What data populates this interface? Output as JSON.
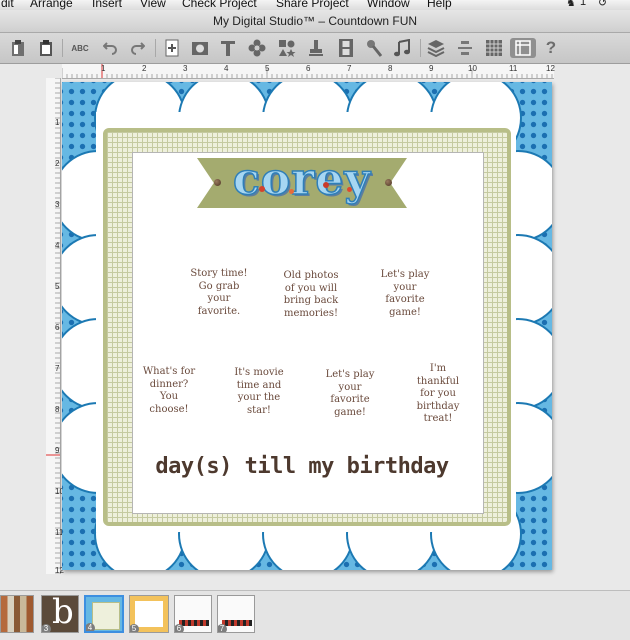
{
  "menubar": {
    "items": [
      "dit",
      "Arrange",
      "Insert",
      "View",
      "Check Project",
      "Share Project",
      "Window",
      "Help"
    ],
    "status_count": "1"
  },
  "window": {
    "title": "My Digital Studio™ – Countdown FUN"
  },
  "toolbar": {
    "icons": [
      "clipboard-icon",
      "paste-icon",
      "spell-check-icon",
      "undo-icon",
      "redo-icon",
      "add-page-icon",
      "photo-box-icon",
      "text-tool-icon",
      "embellishment-icon",
      "shapes-icon",
      "stamp-icon",
      "film-icon",
      "brush-icon",
      "music-icon",
      "layers-icon",
      "align-icon",
      "grid-icon",
      "view-toggle-icon",
      "help-icon"
    ],
    "spell_label": "ABC",
    "help_label": "?"
  },
  "ruler": {
    "horizontal_numbers": [
      "1",
      "2",
      "3",
      "4",
      "5",
      "6",
      "7",
      "8",
      "9",
      "10",
      "11",
      "12"
    ],
    "vertical_numbers": [
      "1",
      "2",
      "3",
      "4",
      "5",
      "6",
      "7",
      "8",
      "9",
      "10",
      "11",
      "12"
    ]
  },
  "page": {
    "title_banner": "corey",
    "prompts": [
      "Story time!\nGo grab\nyour\nfavorite.",
      "Old photos\nof you will\nbring back\nmemories!",
      "Let's play\nyour\nfavorite\ngame!",
      "What's for\ndinner?\nYou\nchoose!",
      "It's movie\ntime and\nyour the\nstar!",
      "Let's play\nyour\nfavorite\ngame!",
      "I'm\nthankful\nfor you\nbirthday\ntreat!"
    ],
    "tagline": "day(s) till my birthday"
  },
  "filmstrip": {
    "page_numbers": [
      "3",
      "4",
      "5",
      "6",
      "7"
    ]
  },
  "colors": {
    "page_background": "#66b8e3",
    "dot": "#1b6fb1",
    "frame": "#b8be88",
    "banner": "#a4ab6f",
    "text_brown": "#6a4a3c",
    "selection": "#3d8fe0"
  }
}
